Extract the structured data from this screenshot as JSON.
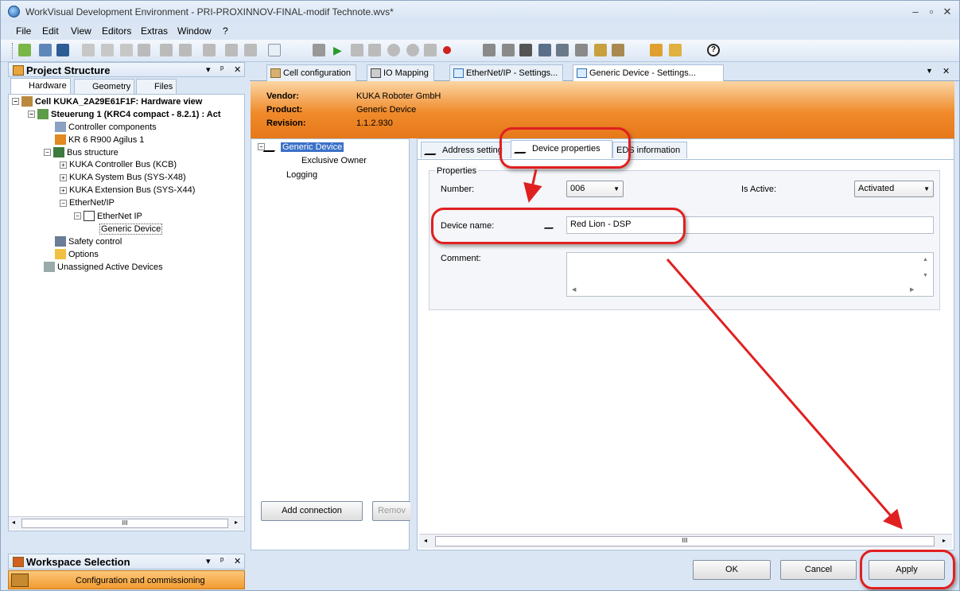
{
  "window": {
    "title": "WorkVisual Development Environment - PRI-PROXINNOV-FINAL-modif Technote.wvs*",
    "min": "–",
    "max": "▫",
    "close": "✕"
  },
  "menu": [
    "File",
    "Edit",
    "View",
    "Editors",
    "Extras",
    "Window",
    "?"
  ],
  "project_panel": {
    "title": "Project Structure",
    "controls": [
      "▾",
      "ᵖ",
      "✕"
    ],
    "tabs": [
      "Hardware",
      "Geometry",
      "Files"
    ],
    "tree": [
      {
        "label": "Cell KUKA_2A29E61F1F: Hardware view",
        "bold": true
      },
      {
        "label": "Steuerung 1 (KRC4 compact - 8.2.1) : Act",
        "bold": true
      },
      {
        "label": "Controller components"
      },
      {
        "label": "KR 6 R900 Agilus 1"
      },
      {
        "label": "Bus structure"
      },
      {
        "label": "KUKA Controller Bus (KCB)"
      },
      {
        "label": "KUKA System Bus (SYS-X48)"
      },
      {
        "label": "KUKA Extension Bus (SYS-X44)"
      },
      {
        "label": "EtherNet/IP"
      },
      {
        "label": "EtherNet IP"
      },
      {
        "label": "Generic Device"
      },
      {
        "label": "Safety control"
      },
      {
        "label": "Options"
      },
      {
        "label": "Unassigned Active Devices"
      }
    ],
    "scroll_mid": "III"
  },
  "workspace_panel": {
    "title": "Workspace Selection",
    "value": "Configuration and commissioning"
  },
  "doc_tabs": [
    "Cell configuration",
    "IO Mapping",
    "EtherNet/IP - Settings...",
    "Generic Device - Settings..."
  ],
  "device_info": {
    "vendor_label": "Vendor:",
    "vendor": "KUKA Roboter GmbH",
    "product_label": "Product:",
    "product": "Generic Device",
    "revision_label": "Revision:",
    "revision": "1.1.2.930"
  },
  "conn_tree": [
    "Generic Device",
    "Exclusive Owner",
    "Logging"
  ],
  "left_buttons": {
    "add": "Add connection",
    "remove": "Remov"
  },
  "prop_tabs": [
    "Address setting",
    "Device properties",
    "EDS information"
  ],
  "properties": {
    "group": "Properties",
    "number_label": "Number:",
    "number": "006",
    "active_label": "Is Active:",
    "active": "Activated",
    "name_label": "Device name:",
    "name": "Red Lion - DSP",
    "comment_label": "Comment:",
    "comment": ""
  },
  "scroll_mid": "III",
  "footer": {
    "ok": "OK",
    "cancel": "Cancel",
    "apply": "Apply"
  },
  "accent": "#e02020"
}
